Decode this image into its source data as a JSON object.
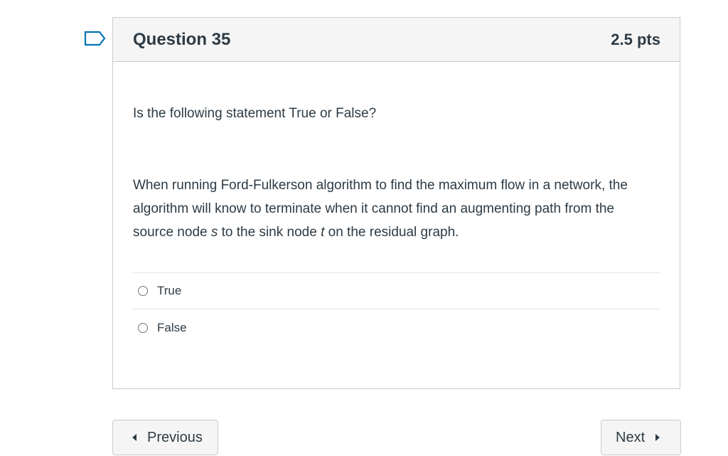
{
  "question": {
    "title": "Question 35",
    "points": "2.5 pts",
    "prompt": "Is the following statement True or False?",
    "statement": {
      "part1": "When running Ford-Fulkerson algorithm to find the maximum flow in a network,  the algorithm will know to terminate when it cannot find an augmenting path from the source node ",
      "source_var": "s",
      "part2": " to the sink node ",
      "sink_var": "t",
      "part3": " on the residual graph."
    },
    "answers": [
      {
        "label": "True",
        "selected": false
      },
      {
        "label": "False",
        "selected": false
      }
    ]
  },
  "navigation": {
    "previous_label": "Previous",
    "next_label": "Next"
  },
  "icons": {
    "flag": "flag-icon",
    "previous": "triangle-left-icon",
    "next": "triangle-right-icon"
  },
  "colors": {
    "text": "#2d3b45",
    "flag_blue": "#0374b5",
    "header_bg": "#f5f5f5",
    "border": "#c7cdd1"
  }
}
